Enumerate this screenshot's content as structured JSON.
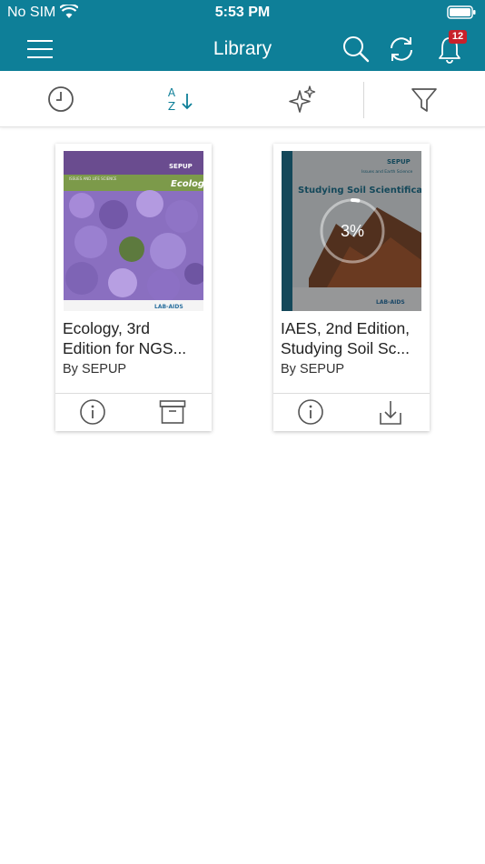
{
  "status_bar": {
    "carrier": "No SIM",
    "time": "5:53 PM"
  },
  "nav": {
    "title": "Library",
    "notification_count": "12"
  },
  "toolbar": {
    "sort_letters_top": "A",
    "sort_letters_bottom": "Z"
  },
  "colors": {
    "brand": "#0e7f98",
    "badge": "#c8212b"
  },
  "books": [
    {
      "title_line1": "Ecology, 3rd",
      "title_line2": "Edition for NGS...",
      "author": "By SEPUP",
      "cover_series": "SEPUP",
      "cover_title": "Ecology",
      "cover_caption": "ISSUES AND LIFE SCIENCE",
      "cover_publisher": "LAB-AIDS",
      "state": "archived"
    },
    {
      "title_line1": "IAES, 2nd Edition,",
      "title_line2": "Studying Soil Sc...",
      "author": "By SEPUP",
      "cover_series": "SEPUP",
      "cover_caption": "Issues and Earth Science",
      "cover_title": "Studying Soil Scientifically",
      "cover_publisher": "LAB-AIDS",
      "state": "downloading",
      "progress_percent": 3,
      "progress_label": "3%"
    }
  ]
}
